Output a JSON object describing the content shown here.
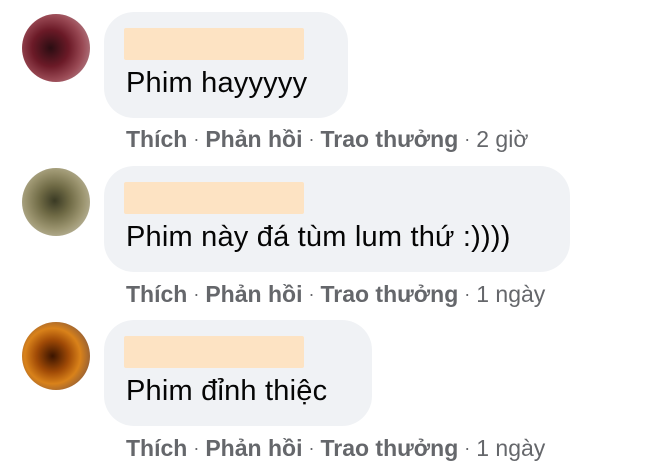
{
  "comments": [
    {
      "text": "Phim hayyyyy",
      "actions": {
        "like": "Thích",
        "reply": "Phản hồi",
        "award": "Trao thưởng"
      },
      "separator": "·",
      "time": "2 giờ"
    },
    {
      "text": "Phim này đá tùm lum thứ :))))",
      "actions": {
        "like": "Thích",
        "reply": "Phản hồi",
        "award": "Trao thưởng"
      },
      "separator": "·",
      "time": "1 ngày"
    },
    {
      "text": "Phim đỉnh thiệc",
      "actions": {
        "like": "Thích",
        "reply": "Phản hồi",
        "award": "Trao thưởng"
      },
      "separator": "·",
      "time": "1 ngày"
    }
  ],
  "colors": {
    "bubble": "#f0f2f5",
    "name_redaction": "#fde3c3",
    "text": "#050505",
    "meta": "#65676b"
  }
}
